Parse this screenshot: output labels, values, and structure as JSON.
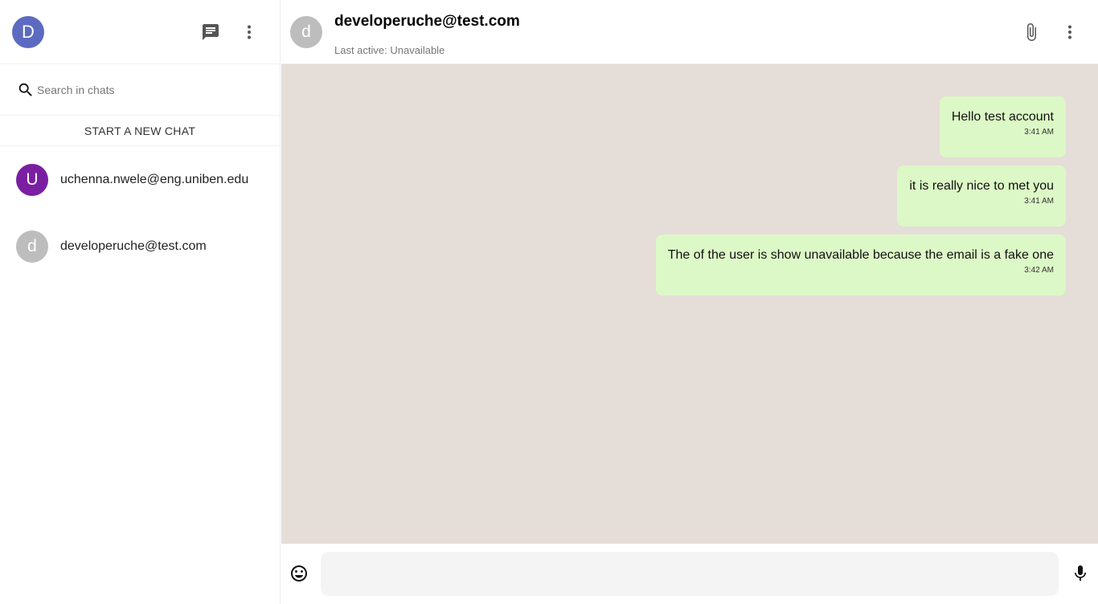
{
  "sidebar": {
    "user_avatar_letter": "D",
    "user_avatar_color": "#5c6bc0",
    "icons": {
      "chat": "chat-icon",
      "more": "more-vert-icon",
      "search": "search-icon"
    },
    "search_placeholder": "Search in chats",
    "new_chat_label": "START A NEW CHAT",
    "chats": [
      {
        "letter": "U",
        "color": "#7b1fa2",
        "name": "uchenna.nwele@eng.uniben.edu"
      },
      {
        "letter": "d",
        "color": "#bdbdbd",
        "name": "developeruche@test.com"
      }
    ]
  },
  "header": {
    "avatar_letter": "d",
    "avatar_color": "#bdbdbd",
    "title": "developeruche@test.com",
    "status": "Last active: Unavailable",
    "icons": {
      "attach": "attach-icon",
      "more": "more-vert-icon"
    }
  },
  "messages": [
    {
      "text": "Hello test account",
      "time": "3:41 AM"
    },
    {
      "text": "it is really nice to met you",
      "time": "3:41 AM"
    },
    {
      "text": "The of the user is show unavailable because the email is a fake one",
      "time": "3:42 AM"
    }
  ],
  "composer": {
    "placeholder": "",
    "icons": {
      "emoji": "emoji-icon",
      "mic": "mic-icon"
    }
  },
  "colors": {
    "chat_background": "#e5ddd8",
    "message_bubble": "#dcf8c6"
  }
}
